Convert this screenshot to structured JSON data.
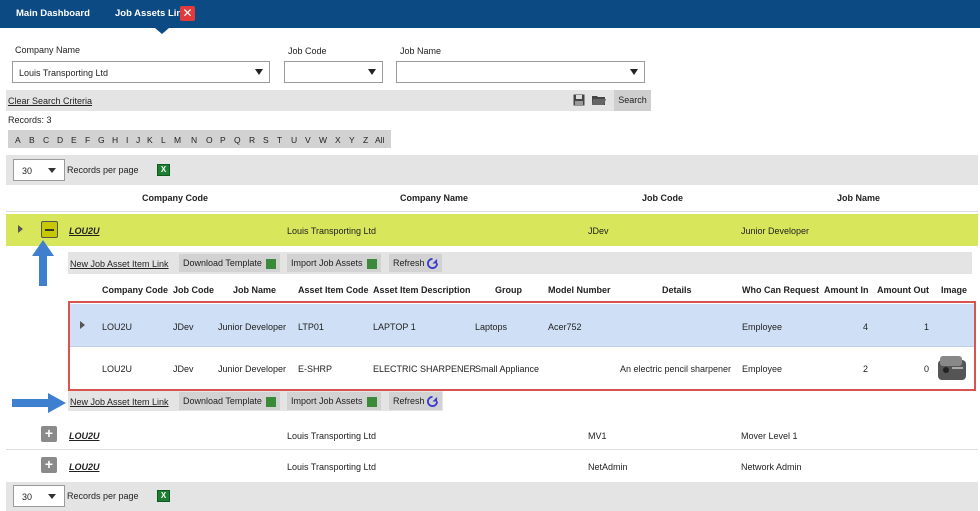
{
  "nav": {
    "tabs": [
      "Main Dashboard",
      "Job Assets Link"
    ],
    "close_label": "✕"
  },
  "search": {
    "company_label": "Company Name",
    "company_value": "Louis Transporting Ltd",
    "jobcode_label": "Job Code",
    "jobname_label": "Job Name",
    "clear_label": "Clear Search Criteria",
    "search_label": "Search"
  },
  "records_text": "Records:  3",
  "alphabet": [
    "A",
    "B",
    "C",
    "D",
    "E",
    "F",
    "G",
    "H",
    "I",
    "J",
    "K",
    "L",
    "M",
    "N",
    "O",
    "P",
    "Q",
    "R",
    "S",
    "T",
    "U",
    "V",
    "W",
    "X",
    "Y",
    "Z",
    "All"
  ],
  "pager": {
    "per_page_value": "30",
    "per_page_label": "Records per page"
  },
  "main_headers": [
    "Company Code",
    "Company Name",
    "Job Code",
    "Job Name"
  ],
  "rows": [
    {
      "code": "LOU2U",
      "name": "Louis Transporting Ltd",
      "jobcode": "JDev",
      "jobname": "Junior Developer"
    },
    {
      "code": "LOU2U",
      "name": "Louis Transporting Ltd",
      "jobcode": "MV1",
      "jobname": "Mover Level 1"
    },
    {
      "code": "LOU2U",
      "name": "Louis Transporting Ltd",
      "jobcode": "NetAdmin",
      "jobname": "Network Admin"
    }
  ],
  "sub_toolbar": {
    "new_link": "New Job Asset Item Link",
    "download": "Download Template",
    "import": "Import Job Assets",
    "refresh": "Refresh"
  },
  "sub_headers": [
    "Company Code",
    "Job Code",
    "Job Name",
    "Asset Item Code",
    "Asset Item Description",
    "Group",
    "Model Number",
    "Details",
    "Who Can Request",
    "Amount In",
    "Amount Out",
    "Image"
  ],
  "sub_rows": [
    {
      "company": "LOU2U",
      "jobcode": "JDev",
      "jobname": "Junior Developer",
      "asset_code": "LTP01",
      "asset_desc": "LAPTOP 1",
      "group": "Laptops",
      "model": "Acer752",
      "details": "",
      "who": "Employee",
      "amount_in": "4",
      "amount_out": "1"
    },
    {
      "company": "LOU2U",
      "jobcode": "JDev",
      "jobname": "Junior Developer",
      "asset_code": "E-SHRP",
      "asset_desc": "ELECTRIC SHARPENER",
      "group": "Small Appliance",
      "model": "",
      "details": "An electric pencil sharpener",
      "who": "Employee",
      "amount_in": "2",
      "amount_out": "0"
    }
  ],
  "colors": {
    "nav": "#0c4a84",
    "expanded_row": "#d7e65a",
    "selected_sub_row": "#cfdff5",
    "highlight": "#d9534f",
    "arrow": "#3f7fd0"
  }
}
